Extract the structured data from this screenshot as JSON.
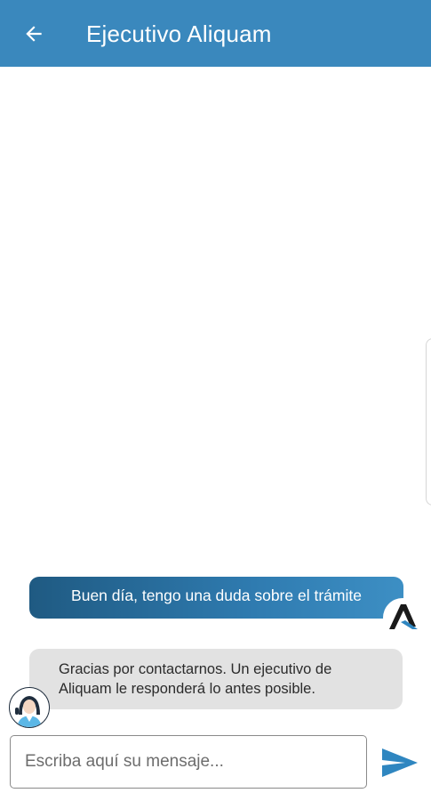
{
  "header": {
    "title": "Ejecutivo Aliquam",
    "back_icon": "arrow-left-icon",
    "background_color": "#3a88bd"
  },
  "messages": [
    {
      "direction": "outgoing",
      "text": "Buen día, tengo una duda sobre el trámite",
      "avatar": "aliquam-logo-icon"
    },
    {
      "direction": "incoming",
      "text": "Gracias por contactarnos. Un ejecutivo de Aliquam le responderá lo antes posible.",
      "avatar": "assistant-avatar"
    }
  ],
  "composer": {
    "placeholder": "Escriba aquí su mensaje...",
    "value": "",
    "send_icon": "send-icon",
    "accent_color": "#2f86c0"
  }
}
